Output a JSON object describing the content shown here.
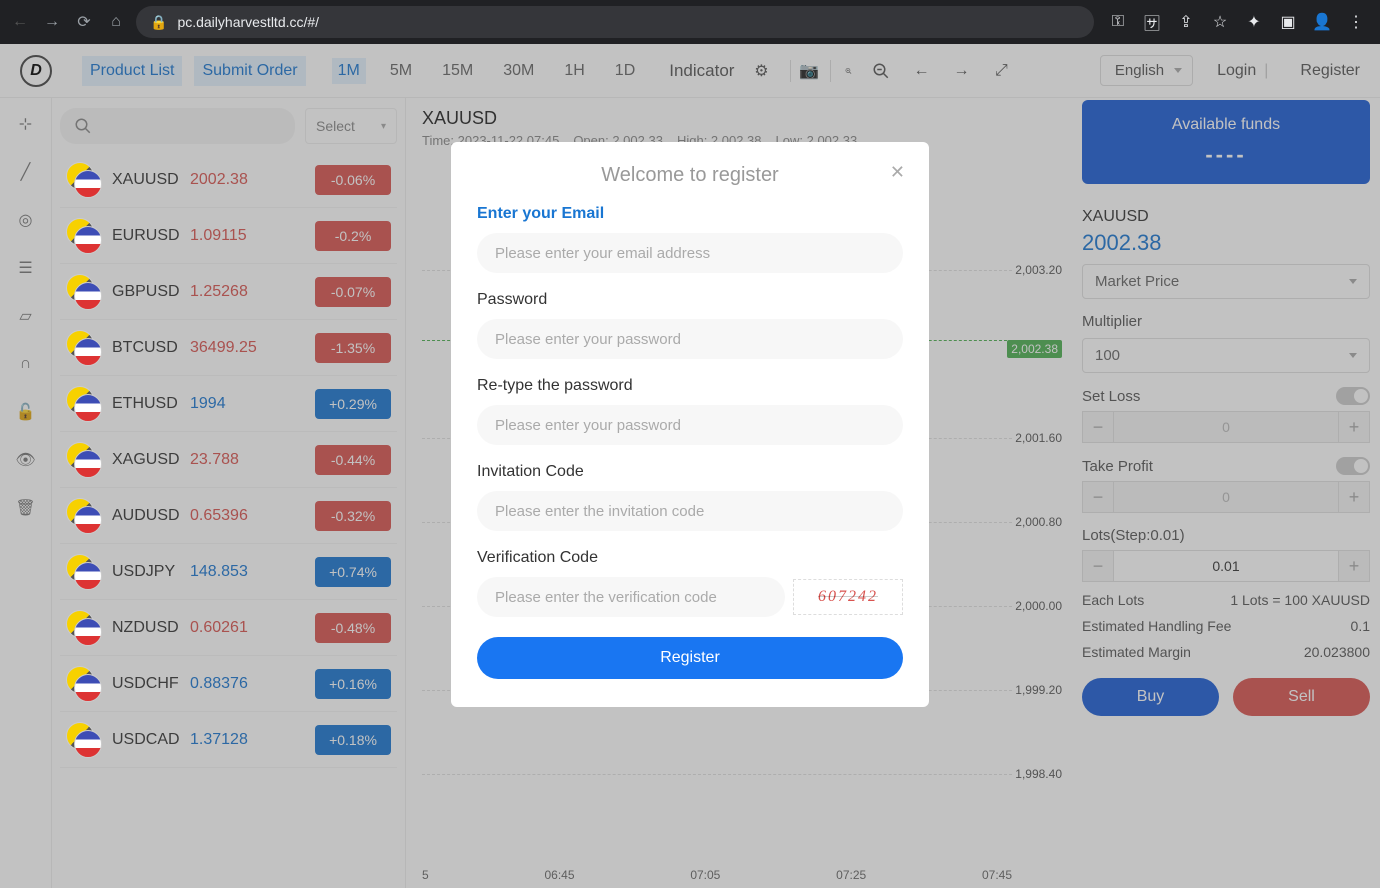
{
  "browser": {
    "url": "pc.dailyharvestltd.cc/#/"
  },
  "header": {
    "tabs": [
      "Product List",
      "Submit Order"
    ],
    "timeframes": [
      "1M",
      "5M",
      "15M",
      "30M",
      "1H",
      "1D"
    ],
    "active_tf": "1M",
    "indicator": "Indicator",
    "language": "English",
    "login": "Login",
    "register": "Register"
  },
  "search": {
    "select": "Select"
  },
  "instruments": [
    {
      "name": "XAUUSD",
      "price": "2002.38",
      "change": "-0.06%",
      "dir": "down"
    },
    {
      "name": "EURUSD",
      "price": "1.09115",
      "change": "-0.2%",
      "dir": "down"
    },
    {
      "name": "GBPUSD",
      "price": "1.25268",
      "change": "-0.07%",
      "dir": "down"
    },
    {
      "name": "BTCUSD",
      "price": "36499.25",
      "change": "-1.35%",
      "dir": "down"
    },
    {
      "name": "ETHUSD",
      "price": "1994",
      "change": "+0.29%",
      "dir": "up"
    },
    {
      "name": "XAGUSD",
      "price": "23.788",
      "change": "-0.44%",
      "dir": "down"
    },
    {
      "name": "AUDUSD",
      "price": "0.65396",
      "change": "-0.32%",
      "dir": "down"
    },
    {
      "name": "USDJPY",
      "price": "148.853",
      "change": "+0.74%",
      "dir": "up"
    },
    {
      "name": "NZDUSD",
      "price": "0.60261",
      "change": "-0.48%",
      "dir": "down"
    },
    {
      "name": "USDCHF",
      "price": "0.88376",
      "change": "+0.16%",
      "dir": "up"
    },
    {
      "name": "USDCAD",
      "price": "1.37128",
      "change": "+0.18%",
      "dir": "up"
    }
  ],
  "chart": {
    "symbol": "XAUUSD",
    "time_label": "Time: 2023-11-22 07:45",
    "open": "Open: 2,002.33",
    "high": "High: 2,002.38",
    "low": "Low: 2,002.33",
    "y_labels": [
      "2,003.20",
      "2,001.60",
      "2,000.80",
      "2,000.00",
      "1,999.20",
      "1,998.40"
    ],
    "price_tag": "2,002.38",
    "x_labels": [
      "5",
      "06:45",
      "07:05",
      "07:25",
      "07:45"
    ]
  },
  "right": {
    "funds_title": "Available funds",
    "funds_value": "----",
    "symbol": "XAUUSD",
    "price": "2002.38",
    "order_type": "Market Price",
    "multiplier_label": "Multiplier",
    "multiplier_value": "100",
    "setloss_label": "Set Loss",
    "setloss_value": "0",
    "takeprofit_label": "Take Profit",
    "takeprofit_value": "0",
    "lots_label": "Lots(Step:0.01)",
    "lots_value": "0.01",
    "each_lots_label": "Each Lots",
    "each_lots_value": "1 Lots = 100 XAUUSD",
    "fee_label": "Estimated Handling Fee",
    "fee_value": "0.1",
    "margin_label": "Estimated Margin",
    "margin_value": "20.023800",
    "buy": "Buy",
    "sell": "Sell"
  },
  "modal": {
    "title": "Welcome to register",
    "email_label": "Enter your Email",
    "email_ph": "Please enter your email address",
    "pw_label": "Password",
    "pw_ph": "Please enter your password",
    "pw2_label": "Re-type the password",
    "pw2_ph": "Please enter your password",
    "invite_label": "Invitation Code",
    "invite_ph": "Please enter the invitation code",
    "code_label": "Verification Code",
    "code_ph": "Please enter the verification code",
    "captcha": "607242",
    "submit": "Register"
  }
}
